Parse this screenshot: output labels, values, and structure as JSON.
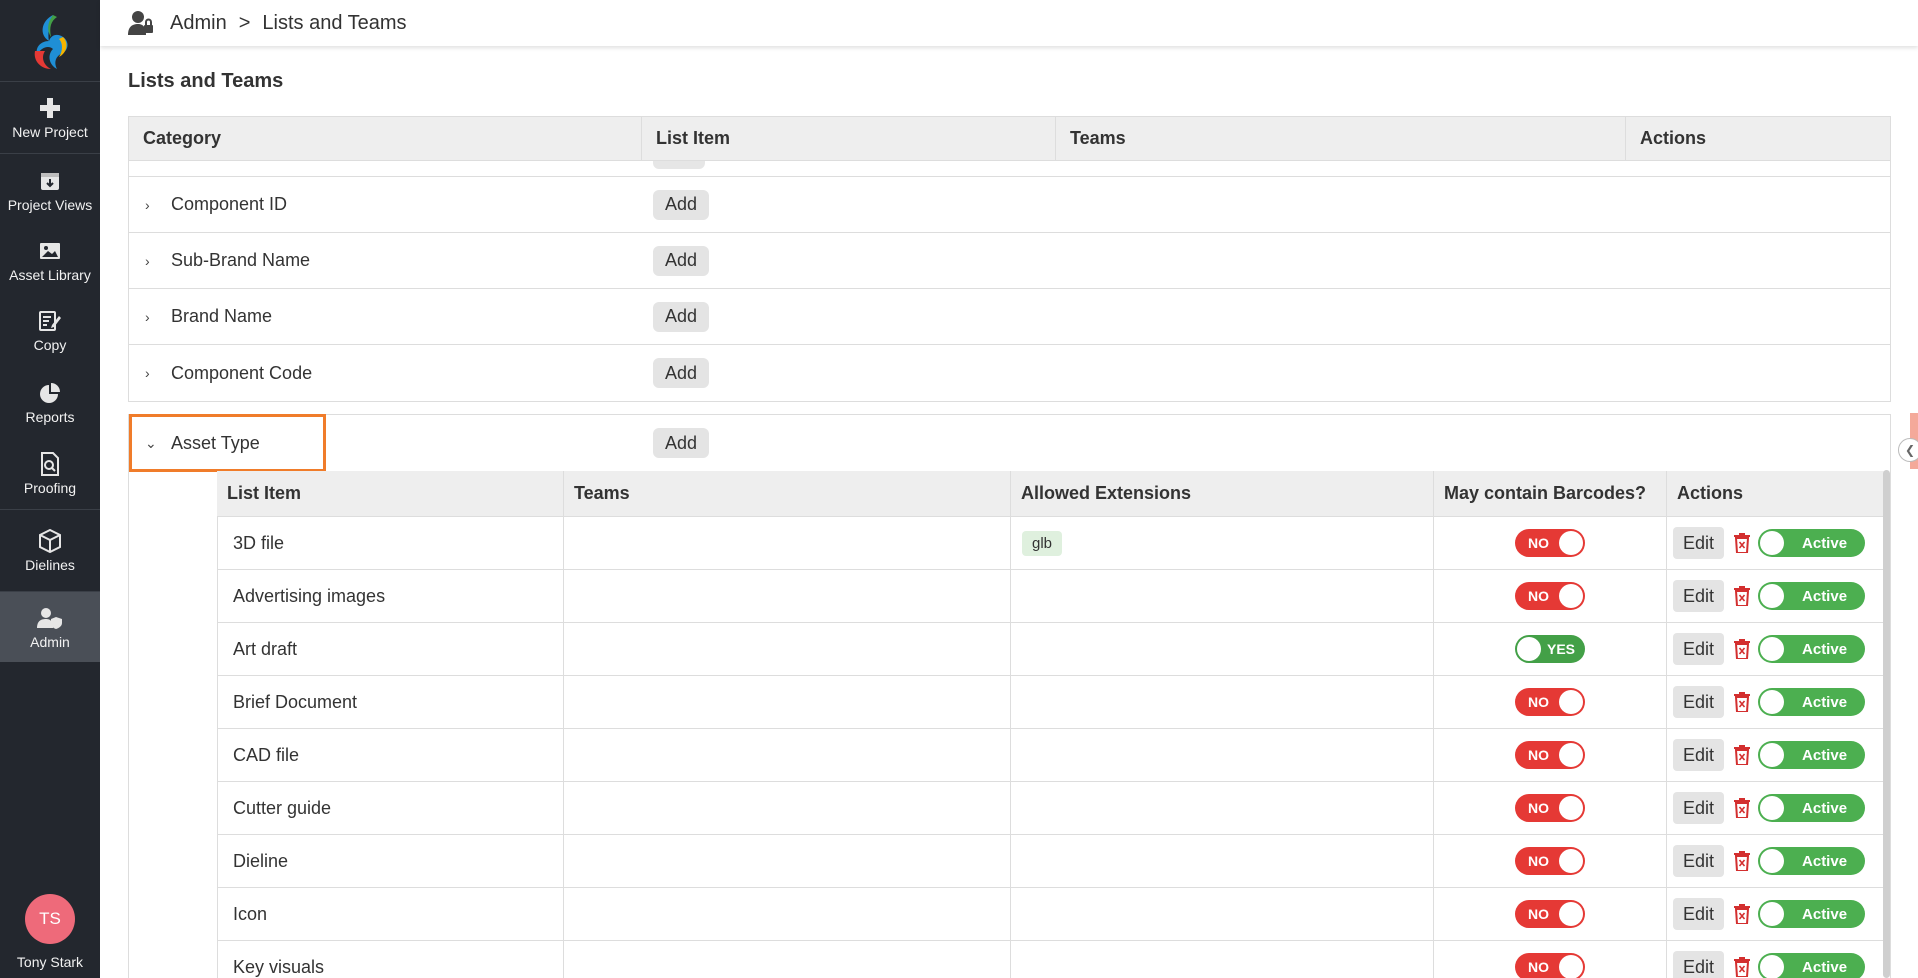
{
  "sidebar": {
    "items": [
      {
        "label": "New Project"
      },
      {
        "label": "Project Views"
      },
      {
        "label": "Asset Library"
      },
      {
        "label": "Copy"
      },
      {
        "label": "Reports"
      },
      {
        "label": "Proofing"
      },
      {
        "label": "Dielines"
      },
      {
        "label": "Admin"
      }
    ],
    "user": {
      "initials": "TS",
      "name": "Tony Stark"
    }
  },
  "header": {
    "section": "Admin",
    "separator": ">",
    "page": "Lists and Teams"
  },
  "page_title": "Lists and Teams",
  "categories": {
    "headers": [
      "Category",
      "List Item",
      "Teams",
      "Actions"
    ],
    "add_label": "Add",
    "rows": [
      {
        "name": "Component ID",
        "chevron": "›"
      },
      {
        "name": "Sub-Brand Name",
        "chevron": "›"
      },
      {
        "name": "Brand Name",
        "chevron": "›"
      },
      {
        "name": "Component Code",
        "chevron": "›"
      }
    ]
  },
  "asset_type": {
    "name": "Asset Type",
    "chevron": "⌄",
    "add_label": "Add",
    "headers": [
      "List Item",
      "Teams",
      "Allowed Extensions",
      "May contain Barcodes?",
      "Actions"
    ],
    "edit_label": "Edit",
    "active_label": "Active",
    "rows": [
      {
        "item": "3D file",
        "ext": "glb",
        "barcode": "NO"
      },
      {
        "item": "Advertising images",
        "ext": "",
        "barcode": "NO"
      },
      {
        "item": "Art draft",
        "ext": "",
        "barcode": "YES"
      },
      {
        "item": "Brief Document",
        "ext": "",
        "barcode": "NO"
      },
      {
        "item": "CAD file",
        "ext": "",
        "barcode": "NO"
      },
      {
        "item": "Cutter guide",
        "ext": "",
        "barcode": "NO"
      },
      {
        "item": "Dieline",
        "ext": "",
        "barcode": "NO"
      },
      {
        "item": "Icon",
        "ext": "",
        "barcode": "NO"
      },
      {
        "item": "Key visuals",
        "ext": "",
        "barcode": "NO"
      }
    ]
  },
  "colors": {
    "sidebar_bg": "#23272e",
    "highlight": "#f07c2a",
    "no": "#e53935",
    "yes": "#43a047",
    "active": "#4caf50",
    "trash": "#d32f2f"
  }
}
